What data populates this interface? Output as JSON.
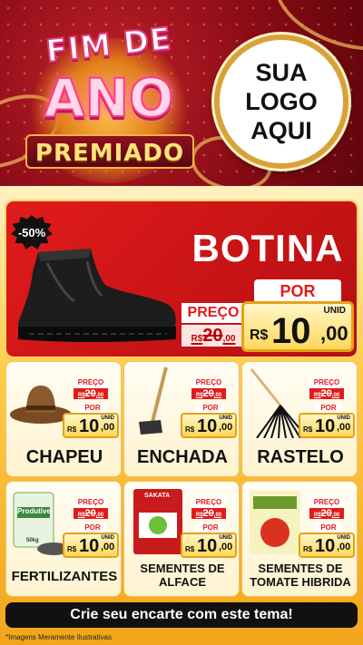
{
  "header": {
    "title_line1": "FIM DE",
    "title_line2": "ANO",
    "title_line3": "PREMIADO",
    "logo_text": "SUA\nLOGO\nAQUI"
  },
  "featured": {
    "discount": "-50%",
    "name": "BOTINA",
    "preco_label": "PREÇO",
    "old_currency": "R$",
    "old_price_int": "20",
    "old_price_cents": ",00",
    "por_label": "POR",
    "unid_label": "UNID",
    "currency": "R$",
    "price_int": "10",
    "price_cents": ",00",
    "image_icon": "boot-icon"
  },
  "products": [
    {
      "name": "CHAPEU",
      "icon": "hat-icon",
      "preco_label": "PREÇO",
      "old_currency": "R$",
      "old_price": "20",
      "old_cents": ",00",
      "por_label": "POR",
      "unid_label": "UNID",
      "currency": "R$",
      "price": "10",
      "cents": ",00"
    },
    {
      "name": "ENCHADA",
      "icon": "hoe-icon",
      "preco_label": "PREÇO",
      "old_currency": "R$",
      "old_price": "20",
      "old_cents": ",00",
      "por_label": "POR",
      "unid_label": "UNID",
      "currency": "R$",
      "price": "10",
      "cents": ",00"
    },
    {
      "name": "RASTELO",
      "icon": "rake-icon",
      "preco_label": "PREÇO",
      "old_currency": "R$",
      "old_price": "20",
      "old_cents": ",00",
      "por_label": "POR",
      "unid_label": "UNID",
      "currency": "R$",
      "price": "10",
      "cents": ",00"
    },
    {
      "name": "FERTILIZANTES",
      "icon": "fertilizer-bag-icon",
      "preco_label": "PREÇO",
      "old_currency": "R$",
      "old_price": "20",
      "old_cents": ",00",
      "por_label": "POR",
      "unid_label": "UNID",
      "currency": "R$",
      "price": "10",
      "cents": ",00"
    },
    {
      "name": "SEMENTES DE\nALFACE",
      "icon": "seed-packet-icon",
      "preco_label": "PREÇO",
      "old_currency": "R$",
      "old_price": "20",
      "old_cents": ",00",
      "por_label": "POR",
      "unid_label": "UNID",
      "currency": "R$",
      "price": "10",
      "cents": ",00"
    },
    {
      "name": "SEMENTES DE\nTOMATE HIBRIDA",
      "icon": "seed-packet-icon",
      "preco_label": "PREÇO",
      "old_currency": "R$",
      "old_price": "20",
      "old_cents": ",00",
      "por_label": "POR",
      "unid_label": "UNID",
      "currency": "R$",
      "price": "10",
      "cents": ",00"
    }
  ],
  "product_images": {
    "fertilizer_brand": "Produtive",
    "fertilizer_weight": "50kg",
    "lettuce_brand": "SAKATA"
  },
  "cta_text": "Crie seu encarte com este tema!",
  "footnote": "*Imagens Meramente Ilustrativas",
  "colors": {
    "accent_red": "#e11b1b",
    "gold": "#f2a51a",
    "dark_red": "#7a0a12"
  }
}
